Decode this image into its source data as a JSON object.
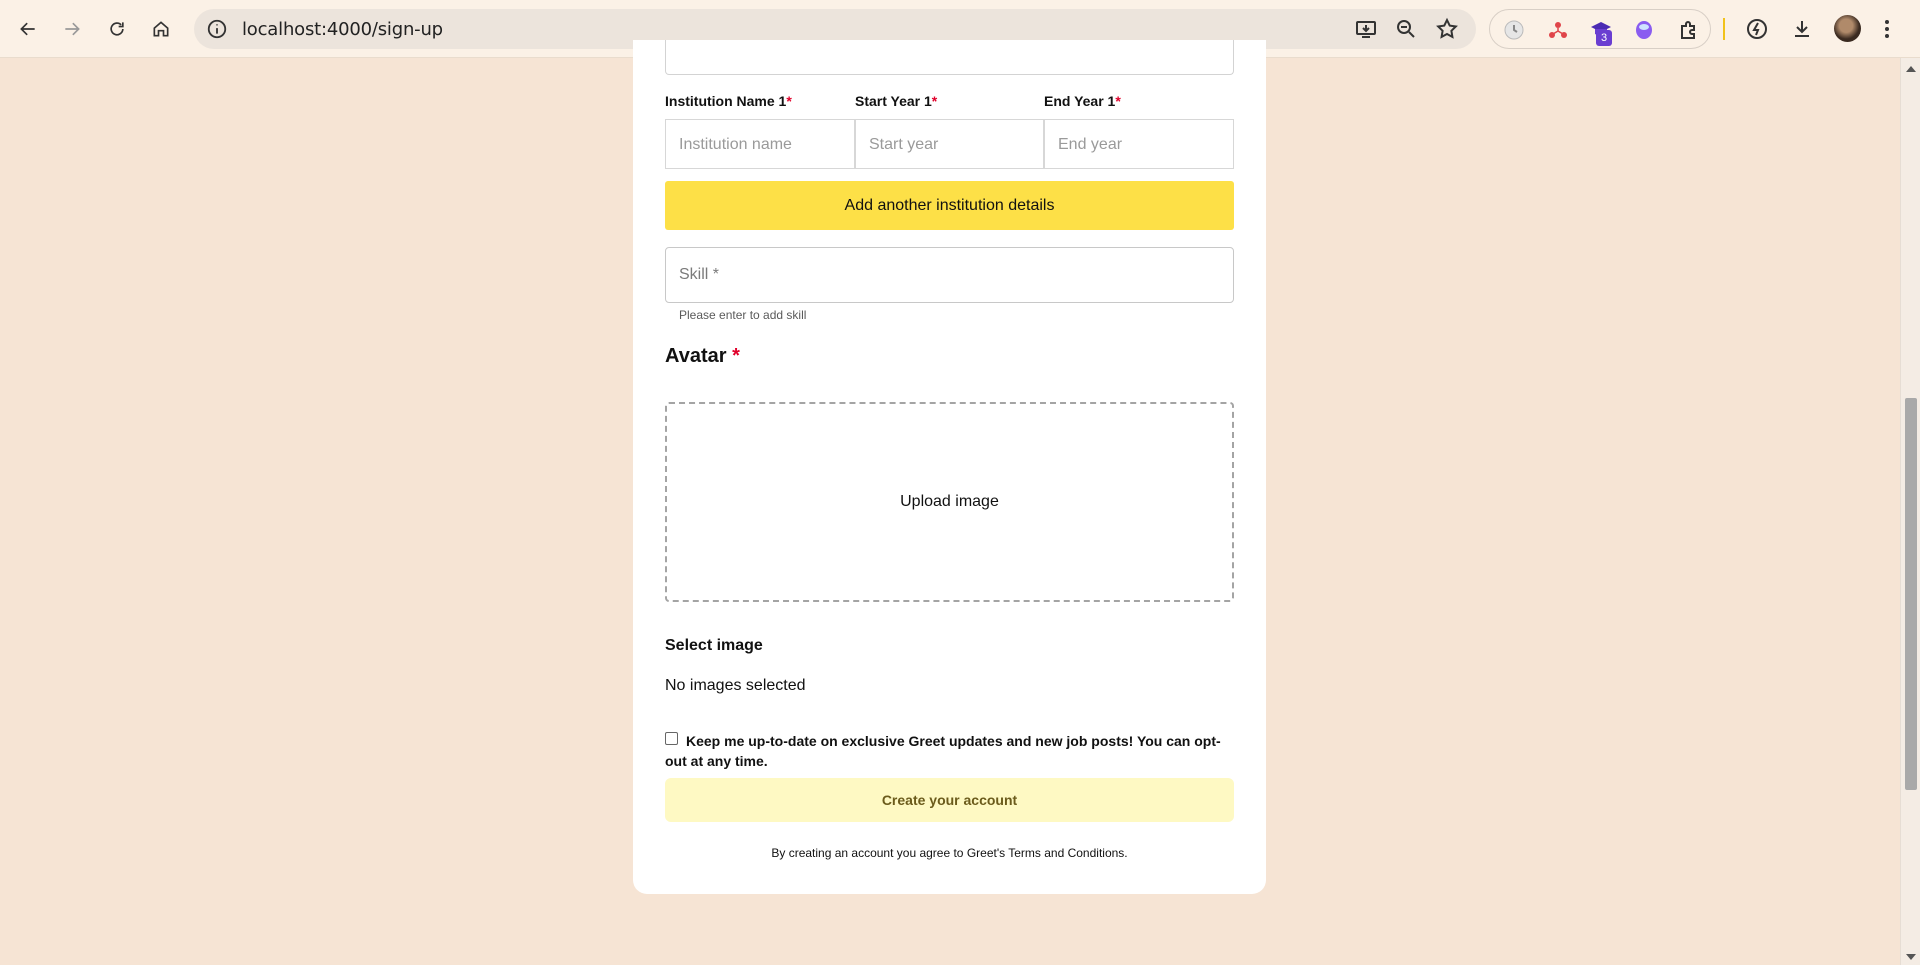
{
  "browser": {
    "url": "localhost:4000/sign-up",
    "extension_badge": "3"
  },
  "form": {
    "institution_label": "Institution Name 1",
    "start_label": "Start Year 1",
    "end_label": "End Year 1",
    "required_mark": "*",
    "institution_placeholder": "Institution name",
    "start_placeholder": "Start year",
    "end_placeholder": "End year",
    "add_institution_button": "Add another institution details",
    "skill_placeholder": "Skill *",
    "skill_helper": "Please enter to add skill",
    "avatar_title": "Avatar",
    "upload_label": "Upload image",
    "select_image_title": "Select image",
    "no_images": "No images selected",
    "optin_text": "Keep me up-to-date on exclusive Greet updates and new job posts! You can opt-out at any time.",
    "create_button": "Create your account",
    "terms_text": "By creating an account you agree to Greet's Terms and Conditions."
  },
  "colors": {
    "page_bg": "#f6e4d4",
    "accent_yellow": "#fde047",
    "create_button_bg": "#fef9c3",
    "required_red": "#e0002a"
  }
}
